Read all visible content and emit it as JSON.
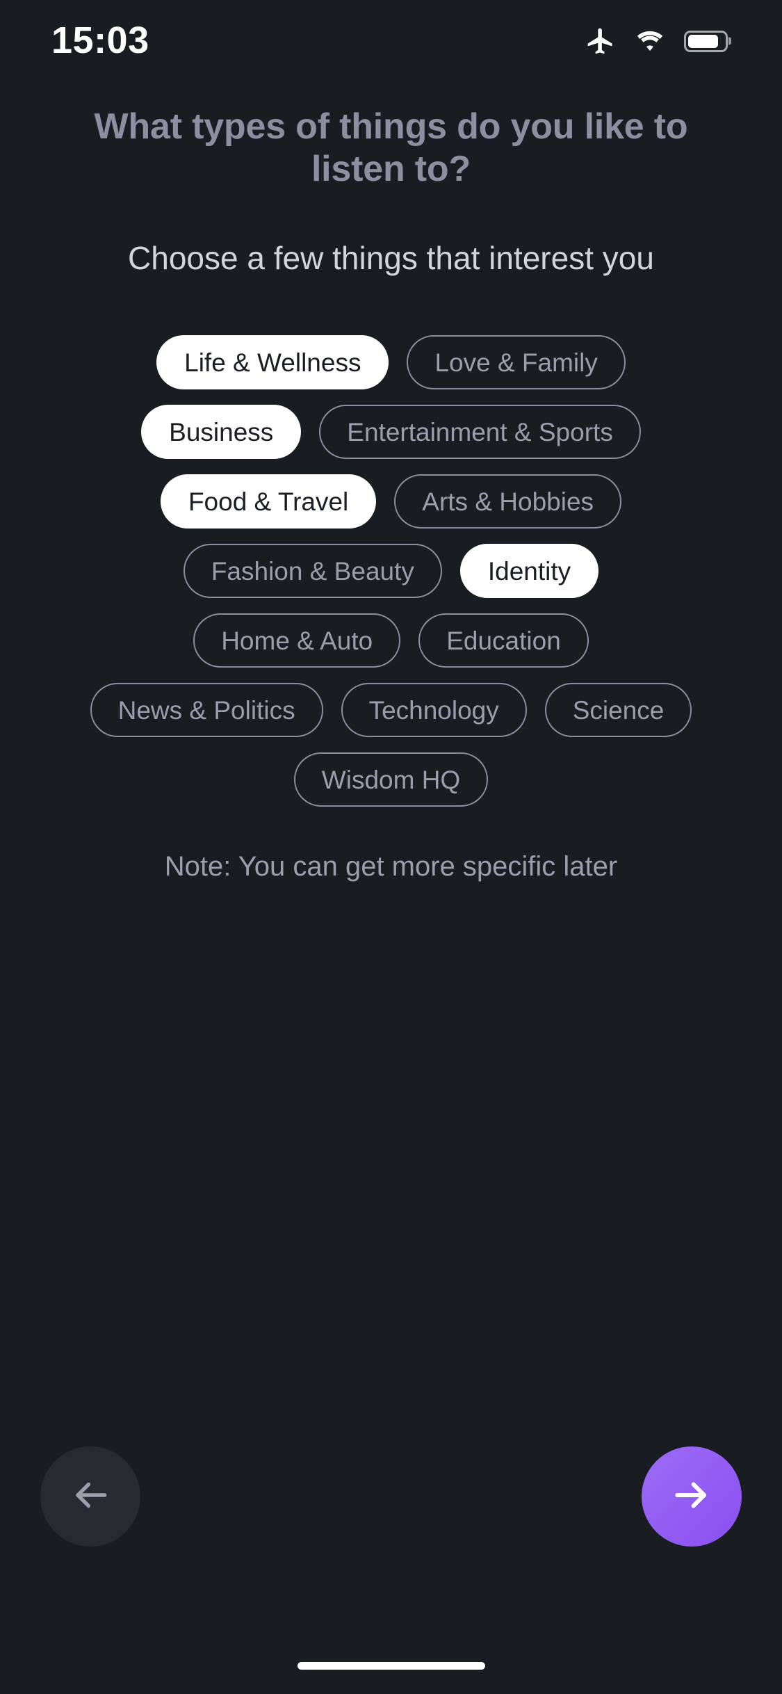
{
  "status_bar": {
    "time": "15:03",
    "icons": [
      "airplane-mode-icon",
      "wifi-icon",
      "battery-icon"
    ]
  },
  "screen": {
    "title": "What types of things do you like to listen to?",
    "subtitle": "Choose a few things that interest you",
    "note": "Note: You can get more specific later"
  },
  "interests": {
    "rows": [
      [
        {
          "label": "Life & Wellness",
          "selected": true
        },
        {
          "label": "Love & Family",
          "selected": false
        }
      ],
      [
        {
          "label": "Business",
          "selected": true
        },
        {
          "label": "Entertainment & Sports",
          "selected": false
        }
      ],
      [
        {
          "label": "Food & Travel",
          "selected": true
        },
        {
          "label": "Arts & Hobbies",
          "selected": false
        }
      ],
      [
        {
          "label": "Fashion & Beauty",
          "selected": false
        },
        {
          "label": "Identity",
          "selected": true
        }
      ],
      [
        {
          "label": "Home & Auto",
          "selected": false
        },
        {
          "label": "Education",
          "selected": false
        }
      ],
      [
        {
          "label": "News & Politics",
          "selected": false
        },
        {
          "label": "Technology",
          "selected": false
        },
        {
          "label": "Science",
          "selected": false
        }
      ],
      [
        {
          "label": "Wisdom HQ",
          "selected": false
        }
      ]
    ]
  },
  "navigation": {
    "back_icon": "arrow-left-icon",
    "next_icon": "arrow-right-icon"
  },
  "colors": {
    "background": "#191c21",
    "title_text": "#8b8fa0",
    "subtitle_text": "#d3d5dc",
    "chip_border": "#8b8fa0",
    "chip_text": "#9b9eac",
    "chip_selected_bg": "#ffffff",
    "chip_selected_text": "#1a1d23",
    "accent": "#8b4ff0",
    "back_button_bg": "#262a31"
  }
}
